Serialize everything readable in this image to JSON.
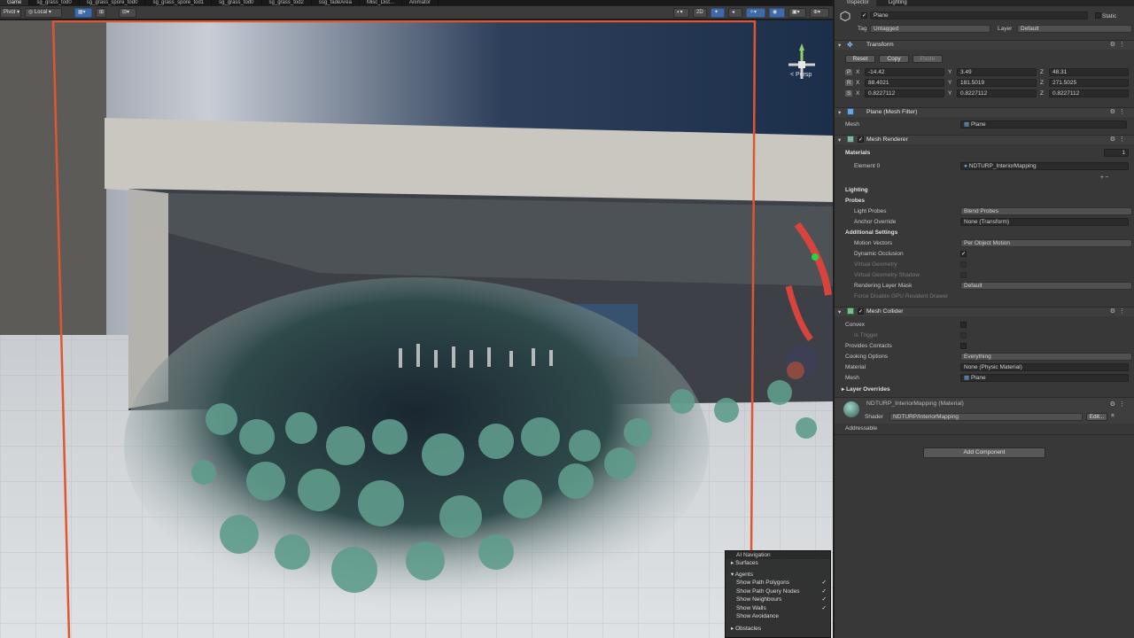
{
  "tabs": [
    "Game",
    "sg_grass_tod0",
    "sg_grass_spore_tod0",
    "sg_grass_spore_tod1",
    "sg_grass_tod0",
    "sg_grass_tod2",
    "ssg_fadeArea",
    "Misc_Dist...",
    "Animator"
  ],
  "toolbar": {
    "pivot": "Pivot",
    "space": "Local",
    "scene_view": "< Persp"
  },
  "ai_navigation": {
    "title": "AI Navigation",
    "surfaces": "Surfaces",
    "agents": "Agents",
    "options": [
      {
        "label": "Show Path Polygons",
        "checked": true
      },
      {
        "label": "Show Path Query Nodes",
        "checked": true
      },
      {
        "label": "Show Neighbours",
        "checked": true
      },
      {
        "label": "Show Walls",
        "checked": true
      },
      {
        "label": "Show Avoidance",
        "checked": false
      }
    ],
    "obstacles": "Obstacles"
  },
  "inspector": {
    "tabs": [
      "Inspector",
      "Lighting"
    ],
    "object_name": "Plane",
    "static_label": "Static",
    "tag_label": "Tag",
    "tag_value": "Untagged",
    "layer_label": "Layer",
    "layer_value": "Default",
    "transform": {
      "title": "Transform",
      "buttons": [
        "Reset",
        "Copy",
        "Paste"
      ],
      "position": {
        "label": "P",
        "x": "-14.42",
        "y": "3.49",
        "z": "48.31"
      },
      "rotation": {
        "label": "R",
        "x": "88.4021",
        "y": "181.5019",
        "z": "271.5025"
      },
      "scale": {
        "label": "S",
        "x": "0.8227112",
        "y": "0.8227112",
        "z": "0.8227112"
      }
    },
    "mesh_filter": {
      "title": "Plane (Mesh Filter)",
      "mesh_label": "Mesh",
      "mesh_value": "Plane"
    },
    "mesh_renderer": {
      "title": "Mesh Renderer",
      "materials_label": "Materials",
      "materials_count": "1",
      "element_label": "Element 0",
      "element_value": "NDTURP_InteriorMapping",
      "lighting_label": "Lighting",
      "probes_label": "Probes",
      "light_probes_label": "Light Probes",
      "light_probes_value": "Blend Probes",
      "anchor_override_label": "Anchor Override",
      "anchor_override_value": "None (Transform)",
      "additional_settings_label": "Additional Settings",
      "motion_vectors_label": "Motion Vectors",
      "motion_vectors_value": "Per Object Motion",
      "dynamic_occlusion_label": "Dynamic Occlusion",
      "virtual_geometry_label": "Virtual Geometry",
      "virtual_geometry_shadow_label": "Virtual Geometry Shadow",
      "rendering_layer_mask_label": "Rendering Layer Mask",
      "rendering_layer_mask_value": "Default",
      "force_disable_label": "Force Disable GPU Resident Drawer"
    },
    "mesh_collider": {
      "title": "Mesh Collider",
      "convex_label": "Convex",
      "is_trigger_label": "Is Trigger",
      "provides_contacts_label": "Provides Contacts",
      "cooking_options_label": "Cooking Options",
      "cooking_options_value": "Everything",
      "material_label": "Material",
      "material_value": "None (Physic Material)",
      "mesh_label": "Mesh",
      "mesh_value": "Plane",
      "layer_overrides_label": "Layer Overrides"
    },
    "material": {
      "title": "NDTURP_InteriorMapping (Material)",
      "shader_label": "Shader",
      "shader_value": "NDTURP/InteriorMapping",
      "edit_label": "Edit..."
    },
    "addressable_label": "Addressable",
    "add_component_label": "Add Component"
  }
}
